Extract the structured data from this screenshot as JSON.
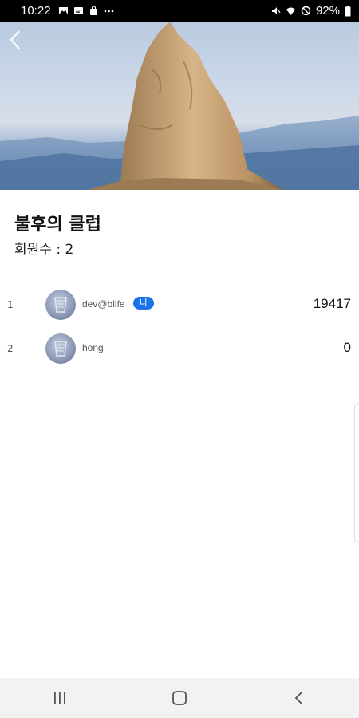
{
  "status_bar": {
    "time": "10:22",
    "battery": "92%",
    "icons": [
      "gallery-icon",
      "message-icon",
      "bag-icon",
      "more-icon",
      "mute-icon",
      "wifi-icon",
      "dnd-icon",
      "battery-icon"
    ]
  },
  "hero": {
    "back_icon": "chevron-left-icon"
  },
  "club": {
    "name": "불후의 클럽",
    "member_count": "회원수 : 2"
  },
  "members": [
    {
      "rank": "1",
      "username": "dev@blife",
      "badge": "나",
      "score": "19417"
    },
    {
      "rank": "2",
      "username": "hong",
      "score": "0"
    }
  ],
  "nav": {
    "icons": [
      "recent-apps-icon",
      "home-icon",
      "back-icon"
    ]
  },
  "colors": {
    "badge": "#1a73e8",
    "status_bar": "#000000",
    "nav_bar": "#f2f2f2"
  }
}
